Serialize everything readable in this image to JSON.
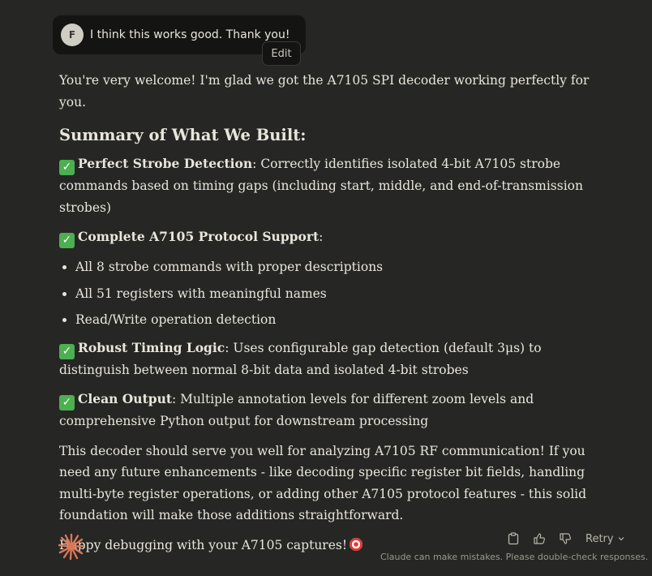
{
  "user_message": {
    "avatar_initial": "F",
    "text": "I think this works good. Thank you!",
    "edit_label": "Edit"
  },
  "response": {
    "intro": "You're very welcome! I'm glad we got the A7105 SPI decoder working perfectly for you.",
    "heading": "Summary of What We Built:",
    "sections": [
      {
        "bold": "Perfect Strobe Detection",
        "text": ": Correctly identifies isolated 4-bit A7105 strobe commands based on timing gaps (including start, middle, and end-of-transmission strobes)"
      },
      {
        "bold": "Complete A7105 Protocol Support",
        "text": ":"
      },
      {
        "bold": "Robust Timing Logic",
        "text": ": Uses configurable gap detection (default 3μs) to distinguish between normal 8-bit data and isolated 4-bit strobes"
      },
      {
        "bold": "Clean Output",
        "text": ": Multiple annotation levels for different zoom levels and comprehensive Python output for downstream processing"
      }
    ],
    "bullets": [
      "All 8 strobe commands with proper descriptions",
      "All 51 registers with meaningful names",
      "Read/Write operation detection"
    ],
    "closing": "This decoder should serve you well for analyzing A7105 RF communication! If you need any future enhancements - like decoding specific register bit fields, handling multi-byte register operations, or adding other A7105 protocol features - this solid foundation will make those additions straightforward.",
    "signoff": "Happy debugging with your A7105 captures!"
  },
  "actions": {
    "copy_icon": "clipboard-icon",
    "thumbs_up_icon": "thumbs-up-icon",
    "thumbs_down_icon": "thumbs-down-icon",
    "retry_label": "Retry"
  },
  "disclaimer": "Claude can make mistakes. Please double-check responses.",
  "colors": {
    "background": "#262624",
    "bubble": "#141413",
    "accent": "#d97757",
    "check": "#4caf50"
  }
}
